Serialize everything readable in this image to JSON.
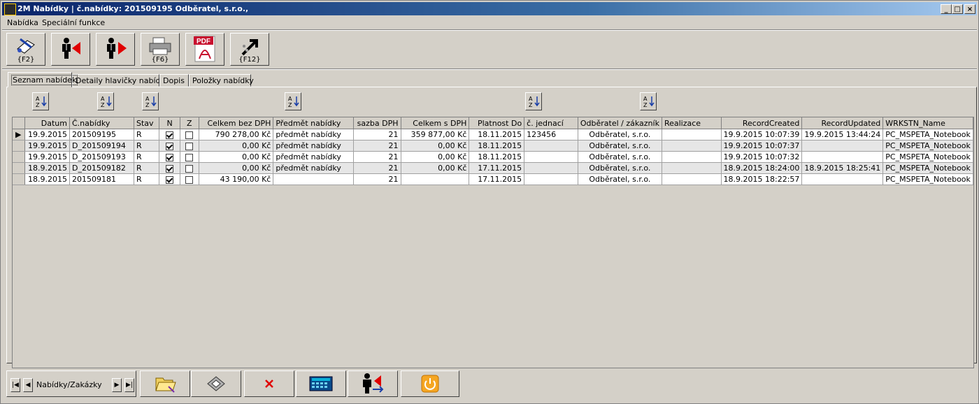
{
  "window": {
    "title": "2M Nabídky | č.nabídky: 201509195  Odběratel, s.r.o.,"
  },
  "menu": [
    "Nabídka",
    "Speciální funkce"
  ],
  "toolbar": [
    {
      "caption": "{F2}",
      "icon": "edit-icon"
    },
    {
      "caption": "",
      "icon": "person-prev-icon"
    },
    {
      "caption": "",
      "icon": "person-next-icon"
    },
    {
      "caption": "{F6}",
      "icon": "printer-icon"
    },
    {
      "caption": "PDF",
      "icon": "pdf-icon"
    },
    {
      "caption": "{F12}",
      "icon": "export-icon"
    }
  ],
  "tabs": [
    "Seznam nabídek",
    "Detaily hlavičky nabídky",
    "Dopis",
    "Položky nabídky"
  ],
  "grid": {
    "columns": [
      "Datum",
      "Č.nabídky",
      "Stav",
      "N",
      "Z",
      "Celkem bez DPH",
      "Předmět nabídky",
      "sazba DPH",
      "Celkem s DPH",
      "Platnost Do",
      "č. jednací",
      "Odběratel / zákazník",
      "Realizace",
      "RecordCreated",
      "RecordUpdated",
      "WRKSTN_Name"
    ],
    "rows": [
      {
        "datum": "19.9.2015",
        "cislo": "201509195",
        "stav": "R",
        "n": true,
        "z": false,
        "bez": "790 278,00 Kč",
        "predmet": "předmět nabídky",
        "sazba": "21",
        "s": "359 877,00 Kč",
        "platnost": "18.11.2015",
        "jednaci": "123456",
        "odberatel": "Odběratel, s.r.o.",
        "realizace": "",
        "created": "19.9.2015 10:07:39",
        "updated": "19.9.2015 13:44:24",
        "wrkstn": "PC_MSPETA_Notebook"
      },
      {
        "datum": "19.9.2015",
        "cislo": "D_201509194",
        "stav": "R",
        "n": true,
        "z": false,
        "bez": "0,00 Kč",
        "predmet": "předmět nabídky",
        "sazba": "21",
        "s": "0,00 Kč",
        "platnost": "18.11.2015",
        "jednaci": "",
        "odberatel": "Odběratel, s.r.o.",
        "realizace": "",
        "created": "19.9.2015 10:07:37",
        "updated": "",
        "wrkstn": "PC_MSPETA_Notebook"
      },
      {
        "datum": "19.9.2015",
        "cislo": "D_201509193",
        "stav": "R",
        "n": true,
        "z": false,
        "bez": "0,00 Kč",
        "predmet": "předmět nabídky",
        "sazba": "21",
        "s": "0,00 Kč",
        "platnost": "18.11.2015",
        "jednaci": "",
        "odberatel": "Odběratel, s.r.o.",
        "realizace": "",
        "created": "19.9.2015 10:07:32",
        "updated": "",
        "wrkstn": "PC_MSPETA_Notebook"
      },
      {
        "datum": "18.9.2015",
        "cislo": "D_201509182",
        "stav": "R",
        "n": true,
        "z": false,
        "bez": "0,00 Kč",
        "predmet": "předmět nabídky",
        "sazba": "21",
        "s": "0,00 Kč",
        "platnost": "17.11.2015",
        "jednaci": "",
        "odberatel": "Odběratel, s.r.o.",
        "realizace": "",
        "created": "18.9.2015 18:24:00",
        "updated": "18.9.2015 18:25:41",
        "wrkstn": "PC_MSPETA_Notebook"
      },
      {
        "datum": "18.9.2015",
        "cislo": "201509181",
        "stav": "R",
        "n": true,
        "z": false,
        "bez": "43 190,00 Kč",
        "predmet": "",
        "sazba": "21",
        "s": "",
        "platnost": "17.11.2015",
        "jednaci": "",
        "odberatel": "Odběratel, s.r.o.",
        "realizace": "",
        "created": "18.9.2015 18:22:57",
        "updated": "",
        "wrkstn": "PC_MSPETA_Notebook"
      }
    ]
  },
  "navigator": {
    "label": "Nabídky/Zakázky"
  },
  "bottom_buttons": [
    "folder-open-icon",
    "save-icon",
    "delete-icon",
    "calculator-icon",
    "person-switch-icon",
    "power-icon"
  ]
}
